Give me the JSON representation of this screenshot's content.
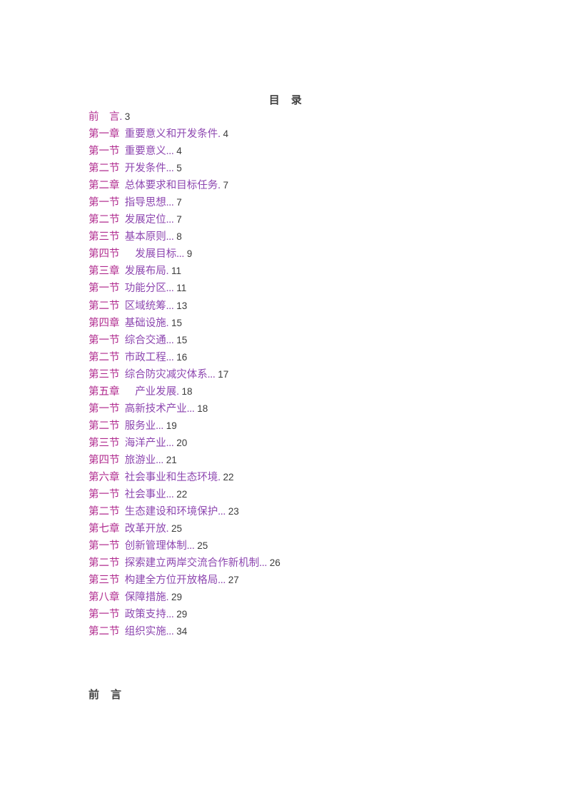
{
  "document": {
    "title": "目　录",
    "title_color": "#404040",
    "background_color": "#ffffff",
    "entry_label_color": "#b02a8e",
    "entry_title_color": "#8d46b0",
    "page_number_color": "#3b3b3b"
  },
  "toc": {
    "entries": [
      {
        "label": "前　言",
        "title": "",
        "leader": ".",
        "page": "3"
      },
      {
        "label": "第一章",
        "title": "重要意义和开发条件",
        "leader": ".",
        "page": "4"
      },
      {
        "label": "第一节",
        "title": "重要意义",
        "leader": "...",
        "page": "4"
      },
      {
        "label": "第二节",
        "title": "开发条件",
        "leader": "...",
        "page": "5"
      },
      {
        "label": "第二章",
        "title": "总体要求和目标任务",
        "leader": ".",
        "page": "7"
      },
      {
        "label": "第一节",
        "title": "指导思想",
        "leader": "...",
        "page": "7"
      },
      {
        "label": "第二节",
        "title": "发展定位",
        "leader": "...",
        "page": "7"
      },
      {
        "label": "第三节",
        "title": "基本原则",
        "leader": "...",
        "page": "8"
      },
      {
        "label": "第四节",
        "title": "　发展目标",
        "leader": "...",
        "page": "9"
      },
      {
        "label": "第三章",
        "title": "发展布局",
        "leader": ".",
        "page": "11"
      },
      {
        "label": "第一节",
        "title": "功能分区",
        "leader": "...",
        "page": "11"
      },
      {
        "label": "第二节",
        "title": "区域统筹",
        "leader": "...",
        "page": "13"
      },
      {
        "label": "第四章",
        "title": "基础设施",
        "leader": ".",
        "page": "15"
      },
      {
        "label": "第一节",
        "title": "综合交通",
        "leader": "...",
        "page": "15"
      },
      {
        "label": "第二节",
        "title": "市政工程",
        "leader": "...",
        "page": "16"
      },
      {
        "label": "第三节",
        "title": "综合防灾减灾体系",
        "leader": "...",
        "page": "17"
      },
      {
        "label": "第五章",
        "title": "　产业发展",
        "leader": ".",
        "page": "18"
      },
      {
        "label": "第一节",
        "title": "高新技术产业",
        "leader": "...",
        "page": "18"
      },
      {
        "label": "第二节",
        "title": "服务业",
        "leader": "...",
        "page": "19"
      },
      {
        "label": "第三节",
        "title": "海洋产业",
        "leader": "...",
        "page": "20"
      },
      {
        "label": "第四节",
        "title": "旅游业",
        "leader": "...",
        "page": "21"
      },
      {
        "label": "第六章",
        "title": "社会事业和生态环境",
        "leader": ".",
        "page": "22"
      },
      {
        "label": "第一节",
        "title": "社会事业",
        "leader": "...",
        "page": "22"
      },
      {
        "label": "第二节",
        "title": "生态建设和环境保护",
        "leader": "...",
        "page": "23"
      },
      {
        "label": "第七章",
        "title": "改革开放",
        "leader": ".",
        "page": "25"
      },
      {
        "label": "第一节",
        "title": "创新管理体制",
        "leader": "...",
        "page": "25"
      },
      {
        "label": "第二节",
        "title": "探索建立两岸交流合作新机制",
        "leader": "...",
        "page": "26"
      },
      {
        "label": "第三节",
        "title": "构建全方位开放格局",
        "leader": "...",
        "page": "27"
      },
      {
        "label": "第八章",
        "title": "保障措施",
        "leader": ".",
        "page": "29"
      },
      {
        "label": "第一节",
        "title": "政策支持",
        "leader": "...",
        "page": "29"
      },
      {
        "label": "第二节",
        "title": "组织实施",
        "leader": "...",
        "page": "34"
      }
    ]
  },
  "section_heading": {
    "text": "前　言"
  }
}
